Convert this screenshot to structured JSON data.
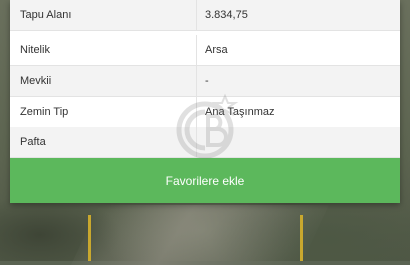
{
  "details": {
    "rows": [
      {
        "label": "Tapu Alanı",
        "value": "3.834,75"
      },
      {
        "label": "Nitelik",
        "value": "Arsa"
      },
      {
        "label": "Mevkii",
        "value": "-"
      },
      {
        "label": "Zemin Tip",
        "value": "Ana Taşınmaz"
      },
      {
        "label": "Pafta",
        "value": ""
      }
    ]
  },
  "actions": {
    "favorite_label": "Favorilere ekle"
  },
  "colors": {
    "button": "#5cb85c"
  }
}
